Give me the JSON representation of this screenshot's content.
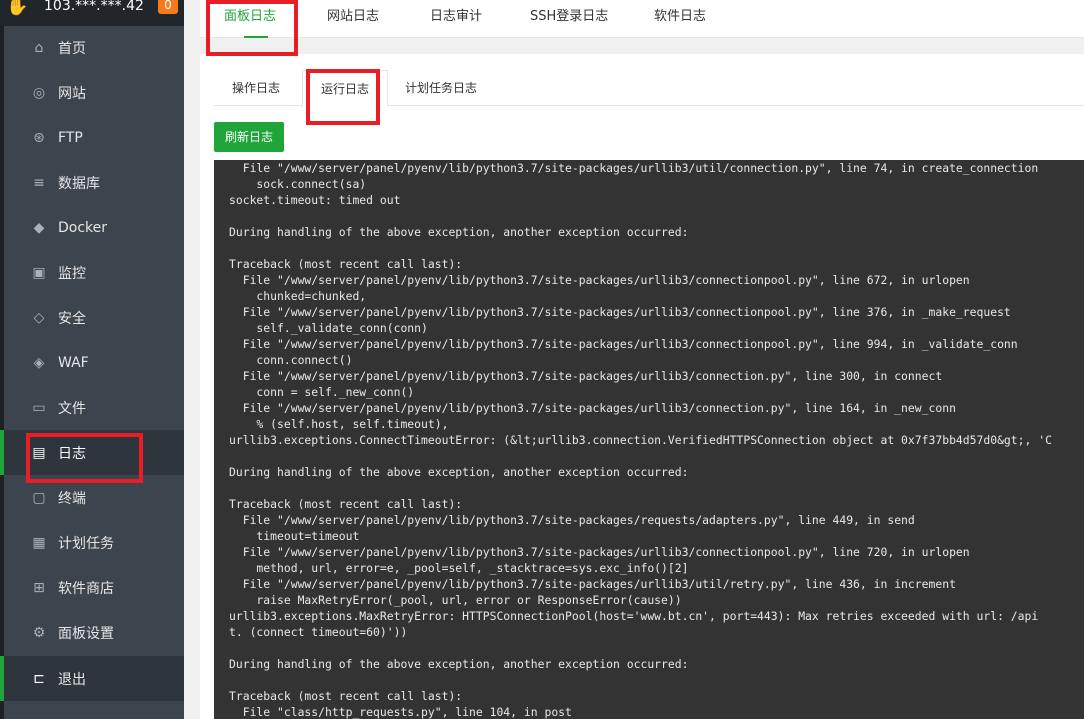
{
  "header": {
    "server": "103.***.***.42",
    "badge": "0"
  },
  "sidebar": {
    "items": [
      {
        "label": "首页",
        "icon": "home-icon",
        "glyph": "⌂"
      },
      {
        "label": "网站",
        "icon": "globe-icon",
        "glyph": "◎"
      },
      {
        "label": "FTP",
        "icon": "ftp-icon",
        "glyph": "⊛"
      },
      {
        "label": "数据库",
        "icon": "database-icon",
        "glyph": "≡"
      },
      {
        "label": "Docker",
        "icon": "docker-icon",
        "glyph": "◆"
      },
      {
        "label": "监控",
        "icon": "monitor-icon",
        "glyph": "▣"
      },
      {
        "label": "安全",
        "icon": "shield-icon",
        "glyph": "◇"
      },
      {
        "label": "WAF",
        "icon": "waf-icon",
        "glyph": "◈"
      },
      {
        "label": "文件",
        "icon": "folder-icon",
        "glyph": "▭"
      },
      {
        "label": "日志",
        "icon": "log-icon",
        "glyph": "▤"
      },
      {
        "label": "终端",
        "icon": "terminal-icon",
        "glyph": "▢"
      },
      {
        "label": "计划任务",
        "icon": "calendar-icon",
        "glyph": "▦"
      },
      {
        "label": "软件商店",
        "icon": "apps-icon",
        "glyph": "⊞"
      },
      {
        "label": "面板设置",
        "icon": "gear-icon",
        "glyph": "⚙"
      },
      {
        "label": "退出",
        "icon": "logout-icon",
        "glyph": "⊏"
      }
    ]
  },
  "top_tabs": [
    "面板日志",
    "网站日志",
    "日志审计",
    "SSH登录日志",
    "软件日志"
  ],
  "sub_tabs": [
    "操作日志",
    "运行日志",
    "计划任务日志"
  ],
  "refresh_label": "刷新日志",
  "log_text": "  File \"/www/server/panel/pyenv/lib/python3.7/site-packages/urllib3/util/connection.py\", line 74, in create_connection\n    sock.connect(sa)\nsocket.timeout: timed out\n\nDuring handling of the above exception, another exception occurred:\n\nTraceback (most recent call last):\n  File \"/www/server/panel/pyenv/lib/python3.7/site-packages/urllib3/connectionpool.py\", line 672, in urlopen\n    chunked=chunked,\n  File \"/www/server/panel/pyenv/lib/python3.7/site-packages/urllib3/connectionpool.py\", line 376, in _make_request\n    self._validate_conn(conn)\n  File \"/www/server/panel/pyenv/lib/python3.7/site-packages/urllib3/connectionpool.py\", line 994, in _validate_conn\n    conn.connect()\n  File \"/www/server/panel/pyenv/lib/python3.7/site-packages/urllib3/connection.py\", line 300, in connect\n    conn = self._new_conn()\n  File \"/www/server/panel/pyenv/lib/python3.7/site-packages/urllib3/connection.py\", line 164, in _new_conn\n    % (self.host, self.timeout),\nurllib3.exceptions.ConnectTimeoutError: (&lt;urllib3.connection.VerifiedHTTPSConnection object at 0x7f37bb4d57d0&gt;, 'C\n\nDuring handling of the above exception, another exception occurred:\n\nTraceback (most recent call last):\n  File \"/www/server/panel/pyenv/lib/python3.7/site-packages/requests/adapters.py\", line 449, in send\n    timeout=timeout\n  File \"/www/server/panel/pyenv/lib/python3.7/site-packages/urllib3/connectionpool.py\", line 720, in urlopen\n    method, url, error=e, _pool=self, _stacktrace=sys.exc_info()[2]\n  File \"/www/server/panel/pyenv/lib/python3.7/site-packages/urllib3/util/retry.py\", line 436, in increment\n    raise MaxRetryError(_pool, url, error or ResponseError(cause))\nurllib3.exceptions.MaxRetryError: HTTPSConnectionPool(host='www.bt.cn', port=443): Max retries exceeded with url: /api\nt. (connect timeout=60)'))\n\nDuring handling of the above exception, another exception occurred:\n\nTraceback (most recent call last):\n  File \"class/http_requests.py\", line 104, in post"
}
